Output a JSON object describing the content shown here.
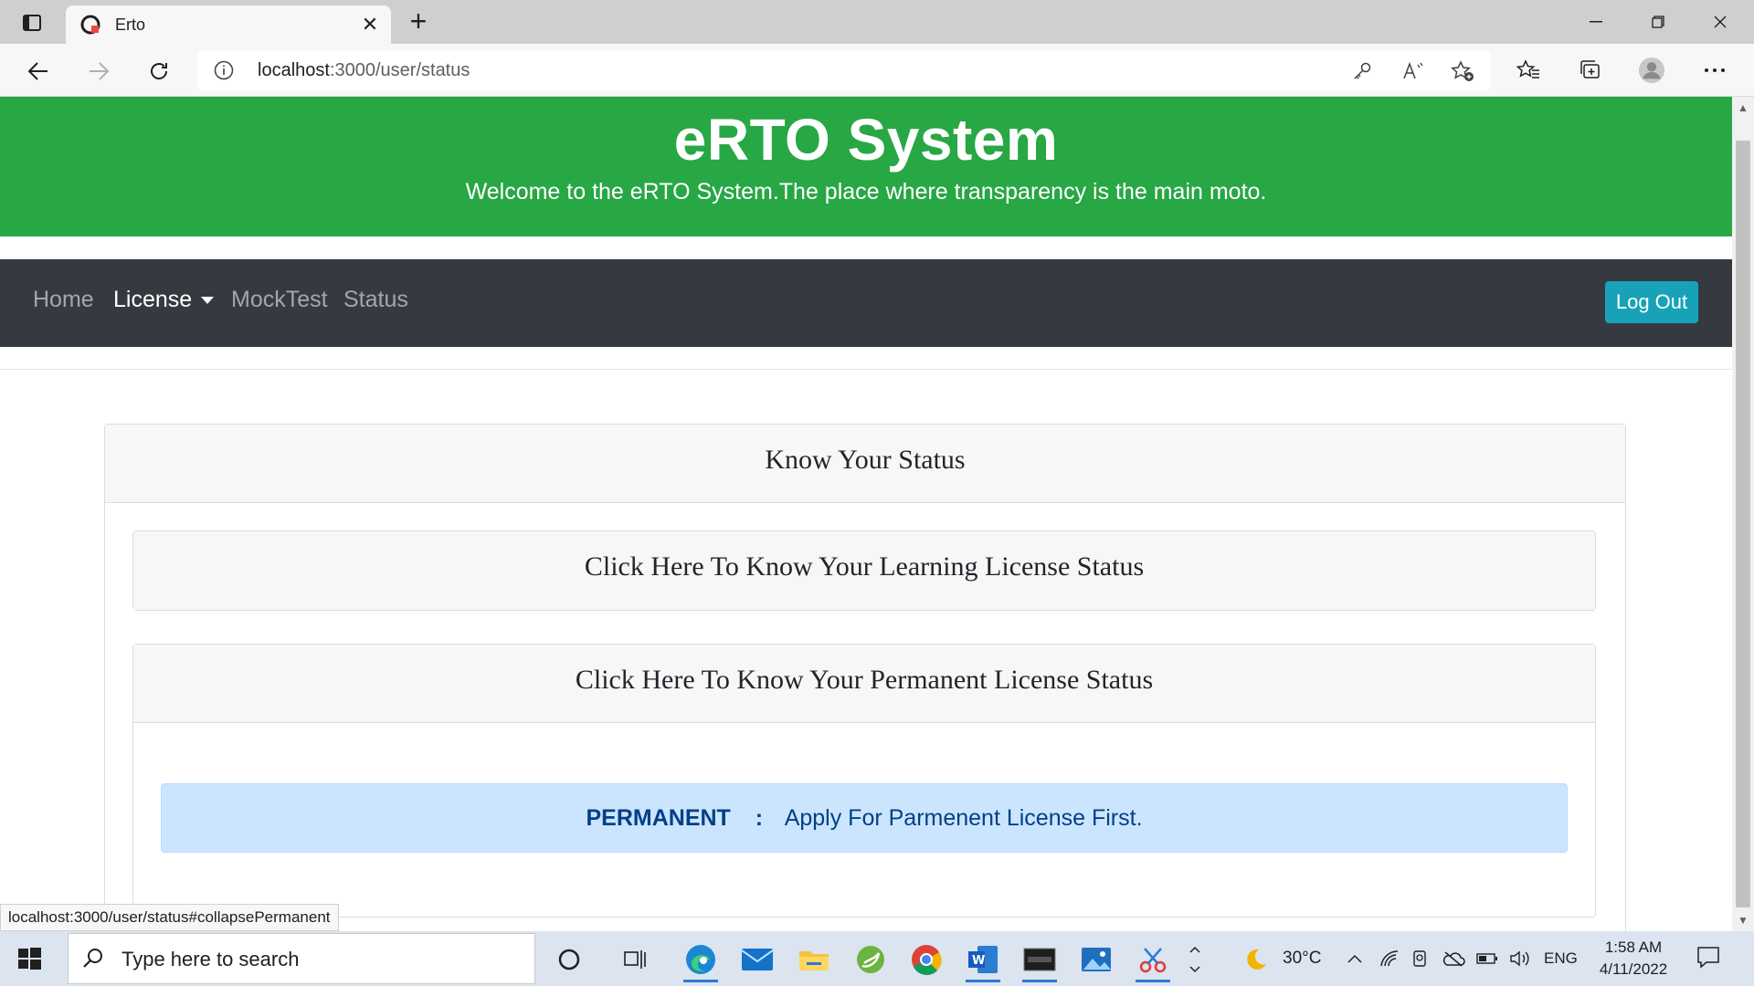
{
  "browser": {
    "tab_title": "Erto",
    "url_host": "localhost",
    "url_path": ":3000/user/status",
    "status_link": "localhost:3000/user/status#collapsePermanent"
  },
  "site": {
    "title": "eRTO System",
    "tagline": "Welcome to the eRTO System.The place where transparency is the main moto.",
    "nav": {
      "home": "Home",
      "license": "License",
      "mocktest": "MockTest",
      "status": "Status",
      "logout": "Log Out"
    },
    "card_title": "Know Your Status",
    "learning_header": "Click Here To Know Your Learning License Status",
    "permanent_header": "Click Here To Know Your Permanent License Status",
    "alert": {
      "label": "PERMANENT",
      "separator": ":",
      "message": "Apply For Parmenent License First."
    }
  },
  "taskbar": {
    "search_placeholder": "Type here to search",
    "weather": "30°C",
    "language": "ENG",
    "time": "1:58 AM",
    "date": "4/11/2022"
  },
  "colors": {
    "jumbotron": "#28a745",
    "navbar": "#343a40",
    "logout": "#17a2b8",
    "alert_bg": "#cce5ff",
    "alert_text": "#004085"
  }
}
